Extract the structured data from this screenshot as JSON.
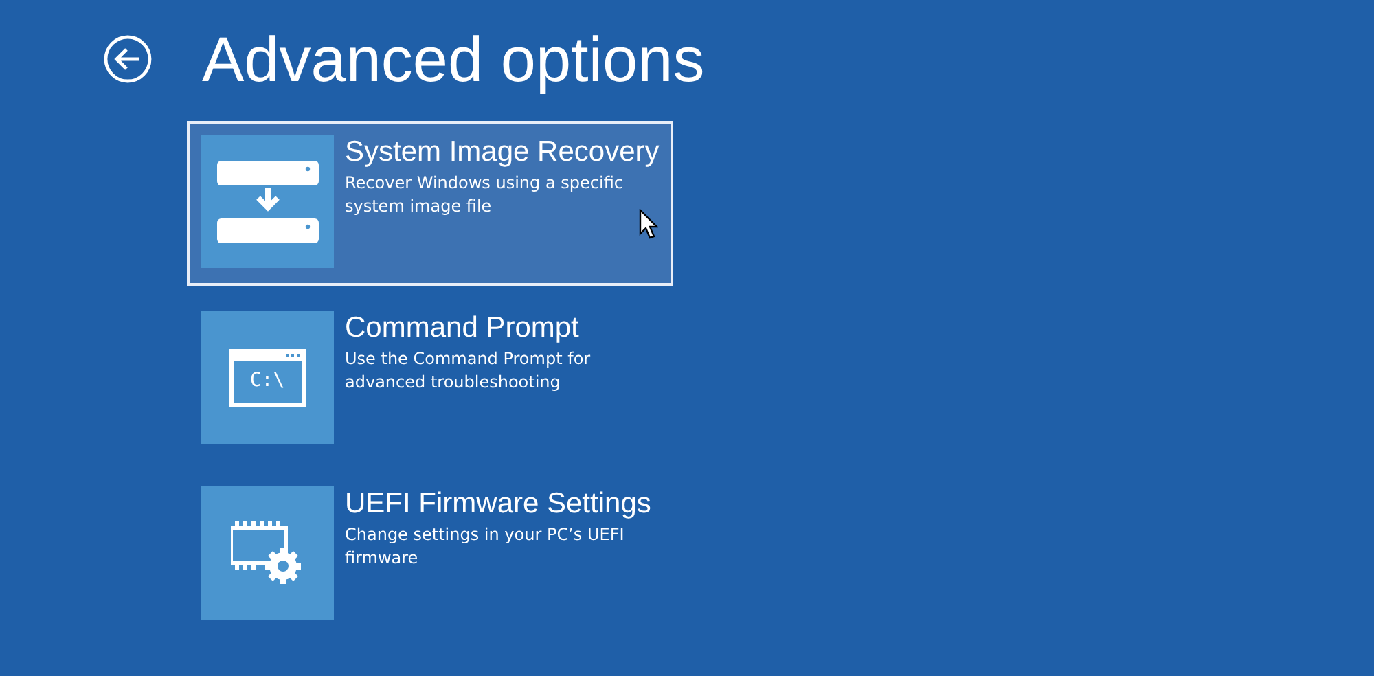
{
  "title": "Advanced options",
  "options": [
    {
      "kind": "image-recovery",
      "title": "System Image Recovery",
      "description": "Recover Windows using a specific system image file",
      "selected": true
    },
    {
      "kind": "command-prompt",
      "title": "Command Prompt",
      "description": "Use the Command Prompt for advanced troubleshooting",
      "icon_text": "C:\\",
      "selected": false
    },
    {
      "kind": "firmware",
      "title": "UEFI Firmware Settings",
      "description": "Change settings in your PC’s UEFI firmware",
      "selected": false
    }
  ]
}
